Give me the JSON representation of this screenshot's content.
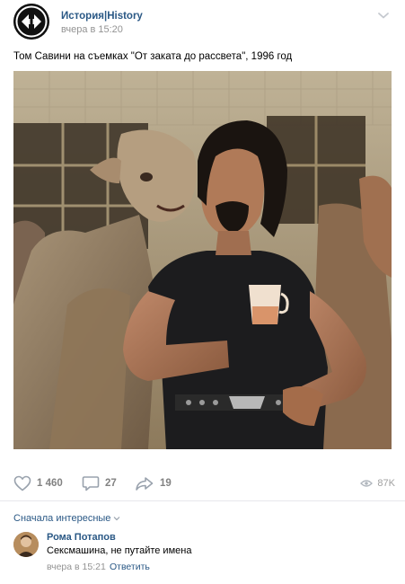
{
  "post": {
    "group_name": "История|History",
    "time": "вчера в 15:20",
    "text": "Том Савини на съемках \"От заката до рассвета\", 1996 год",
    "avatar_icon": "history-logo-icon",
    "photo_alt": "Tom Savini on set with creature costumes"
  },
  "actions": {
    "likes": "1 460",
    "comments": "27",
    "shares": "19",
    "views": "87K"
  },
  "comments_section": {
    "sort_label": "Сначала интересные",
    "items": [
      {
        "author": "Рома Потапов",
        "text": "Сексмашина, не путайте имена",
        "time": "вчера в 15:21",
        "reply_label": "Ответить"
      }
    ]
  },
  "colors": {
    "link": "#2a5885",
    "muted": "#939393",
    "icon": "#99a2ad",
    "divider": "#e7e8ec"
  }
}
